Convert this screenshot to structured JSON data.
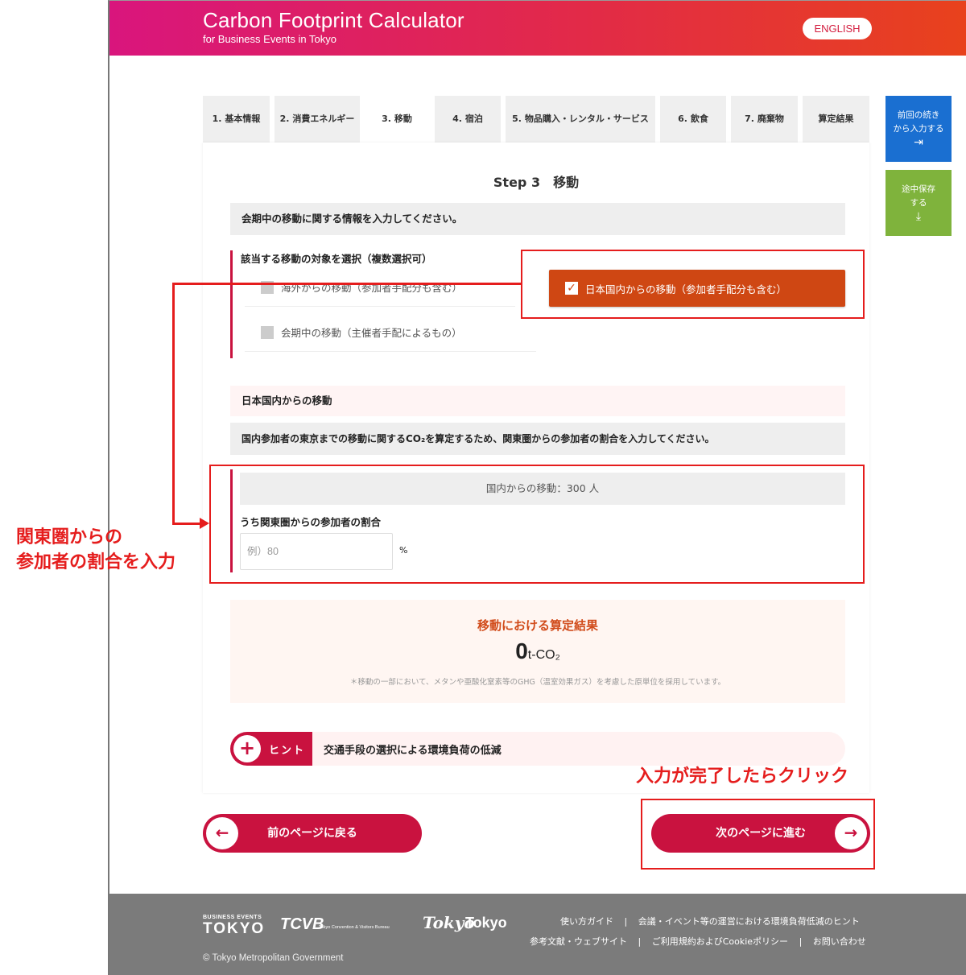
{
  "header": {
    "title": "Carbon Footprint Calculator",
    "subtitle": "for Business Events in Tokyo",
    "language_button": "ENGLISH"
  },
  "tabs": [
    {
      "label": "1. 基本情報"
    },
    {
      "label": "2. 消費エネルギー"
    },
    {
      "label": "3. 移動"
    },
    {
      "label": "4. 宿泊"
    },
    {
      "label": "5. 物品購入・レンタル・サービス"
    },
    {
      "label": "6. 飲食"
    },
    {
      "label": "7. 廃棄物"
    },
    {
      "label": "算定結果"
    }
  ],
  "side_buttons": {
    "resume": {
      "label_1": "前回の続き",
      "label_2": "から入力する",
      "icon": "login-arrow-icon",
      "color": "#1a6fd1"
    },
    "save": {
      "label_1": "途中保存",
      "label_2": "する",
      "icon": "download-icon",
      "color": "#7fb33c"
    }
  },
  "step": {
    "title": "Step 3　移動",
    "intro": "会期中の移動に関する情報を入力してください。"
  },
  "movement_select": {
    "label": "該当する移動の対象を選択（複数選択可）",
    "options": [
      {
        "label": "海外からの移動（参加者手配分も含む）",
        "checked": false
      },
      {
        "label": "日本国内からの移動（参加者手配分も含む）",
        "checked": true
      },
      {
        "label": "会期中の移動（主催者手配によるもの）",
        "checked": false
      }
    ]
  },
  "domestic": {
    "heading": "日本国内からの移動",
    "description": "国内参加者の東京までの移動に関するCO₂を算定するため、関東圏からの参加者の割合を入力してください。",
    "count": "国内からの移動：300 人",
    "ratio_label": "うち関東圏からの参加者の割合",
    "ratio_placeholder": "例）80",
    "ratio_value": "",
    "unit": "%"
  },
  "result": {
    "title": "移動における算定結果",
    "value": "0",
    "unit": "t-CO₂",
    "note": "＊移動の一部において、メタンや亜酸化窒素等のGHG（温室効果ガス）を考慮した原単位を採用しています。"
  },
  "hint": {
    "tag": "ヒント",
    "text": "交通手段の選択による環境負荷の低減"
  },
  "navigation": {
    "prev": "前のページに戻る",
    "next": "次のページに進む"
  },
  "footer": {
    "logo_bet_small": "BUSINESS EVENTS",
    "logo_bet": "TOKYO",
    "logo_tcvb": "TCVB",
    "logo_tcvb_sub": "Tokyo Convention & Visitors Bureau",
    "logo_tokyo_script": "Tokyo",
    "logo_tokyo": "Tokyo",
    "links_row1": [
      "使い方ガイド",
      "会議・イベント等の運営における環境負荷低減のヒント"
    ],
    "links_row2": [
      "参考文献・ウェブサイト",
      "ご利用規約およびCookieポリシー",
      "お問い合わせ"
    ],
    "copyright": "© Tokyo Metropolitan Government"
  },
  "annotations": {
    "ratio_note_1": "関東圏からの",
    "ratio_note_2": "参加者の割合を入力",
    "next_note": "入力が完了したらクリック",
    "color": "#e51d1d"
  }
}
